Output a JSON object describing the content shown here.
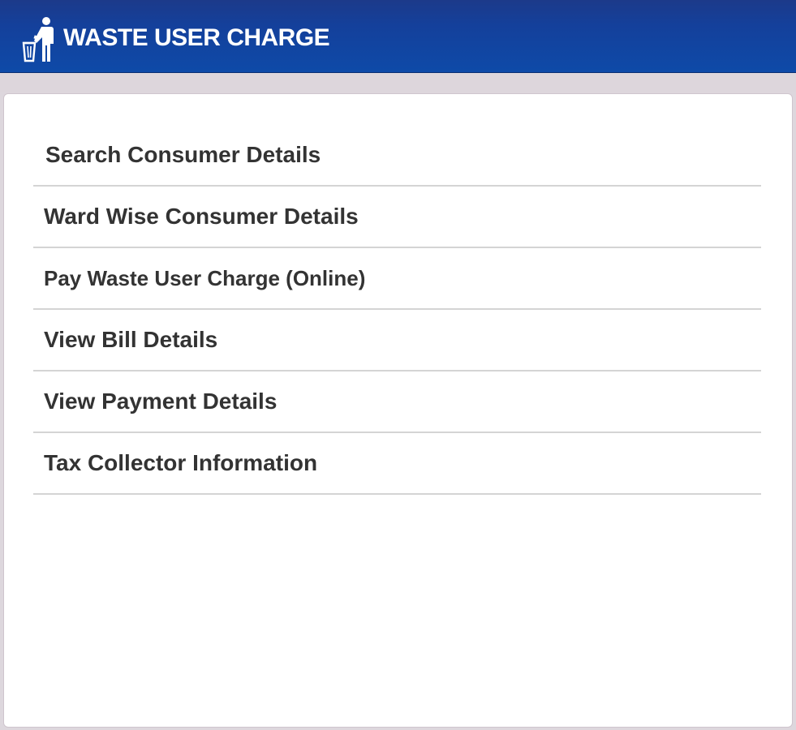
{
  "header": {
    "title": "WASTE USER CHARGE",
    "icon": "waste-disposal-icon"
  },
  "menu": {
    "items": [
      {
        "label": "Search Consumer Details"
      },
      {
        "label": "Ward Wise Consumer Details"
      },
      {
        "label": "Pay Waste User Charge (Online)"
      },
      {
        "label": "View Bill Details"
      },
      {
        "label": "View Payment Details"
      },
      {
        "label": "Tax Collector Information"
      }
    ]
  },
  "colors": {
    "header_top": "#1c3a8a",
    "header_bottom": "#0e4aa8",
    "text": "#333333",
    "divider": "#d4d4d4",
    "page_bg": "#ddd7dd"
  }
}
